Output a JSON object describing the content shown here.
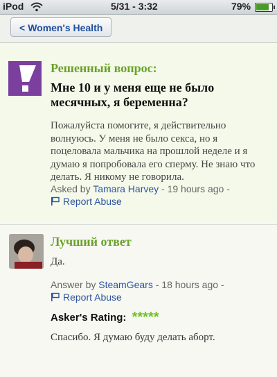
{
  "status_bar": {
    "device": "iPod",
    "wifi_icon": "wifi-icon",
    "time": "5/31 - 3:32",
    "battery_percent": "79%",
    "battery_level": 0.79
  },
  "nav": {
    "back_label": "Women's Health",
    "back_icon": "chevron-left-icon"
  },
  "question": {
    "status": "Решенный вопрос:",
    "title": "Мне  10 и у меня еще не было месячных, я беременна?",
    "body": "Пожалуйста помогите, я действительно волнуюсь. У меня не было секса, но я поцеловала мальчика на прошлой неделе и я думаю я попробовала его сперму. Не знаю что делать. Я никому не говорила.",
    "asked_prefix": "Asked by",
    "asker": "Tamara Harvey",
    "asked_time": "- 19 hours ago -",
    "report_label": "Report Abuse"
  },
  "best_answer": {
    "heading": "Лучший ответ",
    "text": "Да.",
    "answer_prefix": "Answer by",
    "answerer": "SteamGears",
    "answer_time": "- 18 hours ago -",
    "report_label": "Report Abuse",
    "rating_label": "Asker's Rating:",
    "rating_stars": "*****",
    "rating_value": 5,
    "asker_comment": "Спасибо. Я думаю буду делать аборт."
  },
  "colors": {
    "accent_green": "#6aa12a",
    "link_blue": "#2d54a0",
    "logo_purple": "#7b3f9e"
  }
}
